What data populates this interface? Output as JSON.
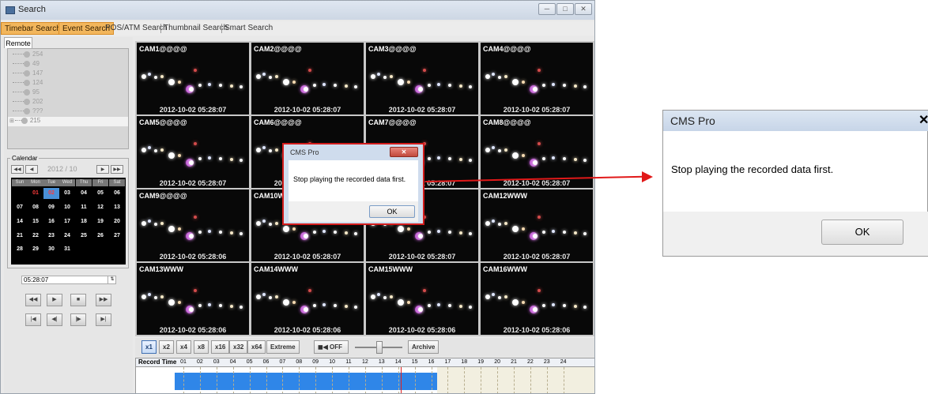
{
  "window": {
    "title": "Search"
  },
  "tabs": {
    "timebar": "Timebar Search",
    "event": "Event Search",
    "pos_atm": "POS/ATM Search",
    "thumbnail": "Thumbnail Search",
    "smart": "Smart Search"
  },
  "sidebar": {
    "remote_tab": "Remote",
    "tree_items": [
      "254",
      "49",
      "147",
      "124",
      "95",
      "202",
      "???",
      "215"
    ],
    "calendar_label": "Calendar",
    "month": "2012 / 10",
    "weekdays": [
      "Sun",
      "Mon",
      "Tue",
      "Wed",
      "Thu",
      "Fri",
      "Sat"
    ],
    "days": [
      "01",
      "02",
      "03",
      "04",
      "05",
      "06",
      "07",
      "08",
      "09",
      "10",
      "11",
      "12",
      "13",
      "14",
      "15",
      "16",
      "17",
      "18",
      "19",
      "20",
      "21",
      "22",
      "23",
      "24",
      "25",
      "26",
      "27",
      "28",
      "29",
      "30",
      "31"
    ],
    "time": "05:28:07"
  },
  "cameras": [
    {
      "name": "CAM1@@@@",
      "ts": "2012-10-02 05:28:07"
    },
    {
      "name": "CAM2@@@@",
      "ts": "2012-10-02 05:28:07"
    },
    {
      "name": "CAM3@@@@",
      "ts": "2012-10-02 05:28:07"
    },
    {
      "name": "CAM4@@@@",
      "ts": "2012-10-02 05:28:07"
    },
    {
      "name": "CAM5@@@@",
      "ts": "2012-10-02 05:28:07"
    },
    {
      "name": "CAM6@@@@",
      "ts": "2012-10-02 05:28:07"
    },
    {
      "name": "CAM7@@@@",
      "ts": "2012-10-02 05:28:07"
    },
    {
      "name": "CAM8@@@@",
      "ts": "2012-10-02 05:28:07"
    },
    {
      "name": "CAM9@@@@",
      "ts": "2012-10-02 05:28:06"
    },
    {
      "name": "CAM10WWW",
      "ts": "2012-10-02 05:28:07"
    },
    {
      "name": "CAM11WWW",
      "ts": "2012-10-02 05:28:07"
    },
    {
      "name": "CAM12WWW",
      "ts": "2012-10-02 05:28:07"
    },
    {
      "name": "CAM13WWW",
      "ts": "2012-10-02 05:28:06"
    },
    {
      "name": "CAM14WWW",
      "ts": "2012-10-02 05:28:06"
    },
    {
      "name": "CAM15WWW",
      "ts": "2012-10-02 05:28:06"
    },
    {
      "name": "CAM16WWW",
      "ts": "2012-10-02 05:28:06"
    }
  ],
  "speed": {
    "x1": "x1",
    "x2": "x2",
    "x4": "x4",
    "x8": "x8",
    "x16": "x16",
    "x32": "x32",
    "x64": "x64",
    "extreme": "Extreme",
    "audio": "OFF",
    "archive": "Archive"
  },
  "timeline": {
    "label": "Record Time",
    "hours": [
      "01",
      "02",
      "03",
      "04",
      "05",
      "06",
      "07",
      "08",
      "09",
      "10",
      "11",
      "12",
      "13",
      "14",
      "15",
      "16",
      "17",
      "18",
      "19",
      "20",
      "21",
      "22",
      "23",
      "24"
    ]
  },
  "dialog_small": {
    "title": "CMS Pro",
    "message": "Stop playing the recorded data first.",
    "ok": "OK"
  },
  "dialog_zoom": {
    "title": "CMS Pro",
    "message": "Stop playing the recorded data first.",
    "ok": "OK"
  },
  "colors": {
    "accent_tab": "#f2b65c",
    "record_bar": "#2f86e8",
    "highlight": "#e11919"
  }
}
